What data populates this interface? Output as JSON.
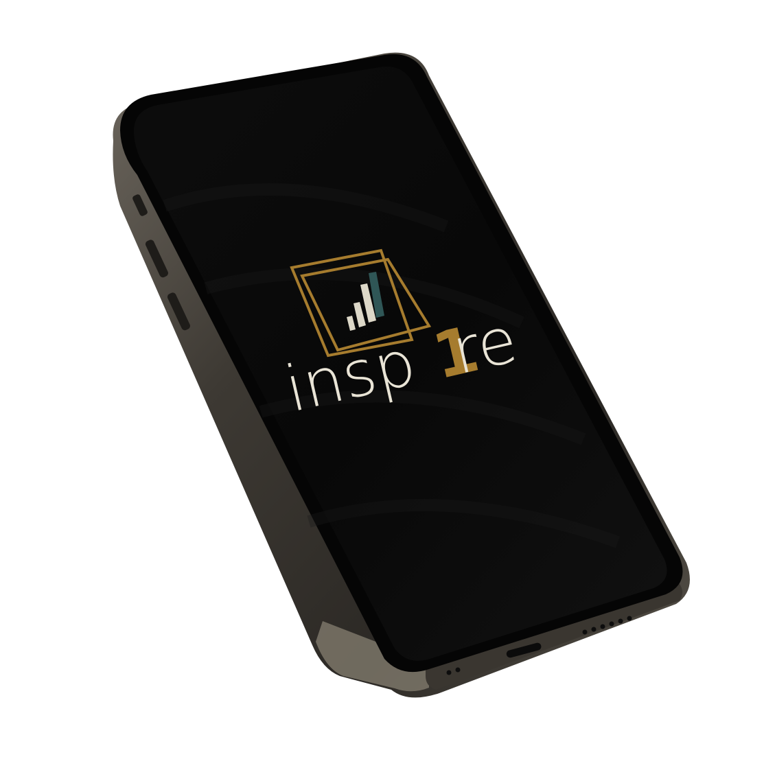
{
  "scene": {
    "background_color": "#ffffff",
    "phone": {
      "frame_color": "#3b3731",
      "frame_highlight": "#8a8478",
      "bezel_color": "#050505",
      "screen_color": "#0b0b0b"
    }
  },
  "app_logo": {
    "wordmark": "insp1re",
    "wordmark_parts": [
      "insp",
      "1",
      "re"
    ],
    "colors": {
      "frame_gold": "#a67c2e",
      "wordmark_light": "#e9e4d6",
      "one_gold": "#a67c2e",
      "bar_teal": "#2f5656",
      "bar_light": "#ddd8c8"
    },
    "icon": "bar-chart-in-double-frame-icon"
  }
}
